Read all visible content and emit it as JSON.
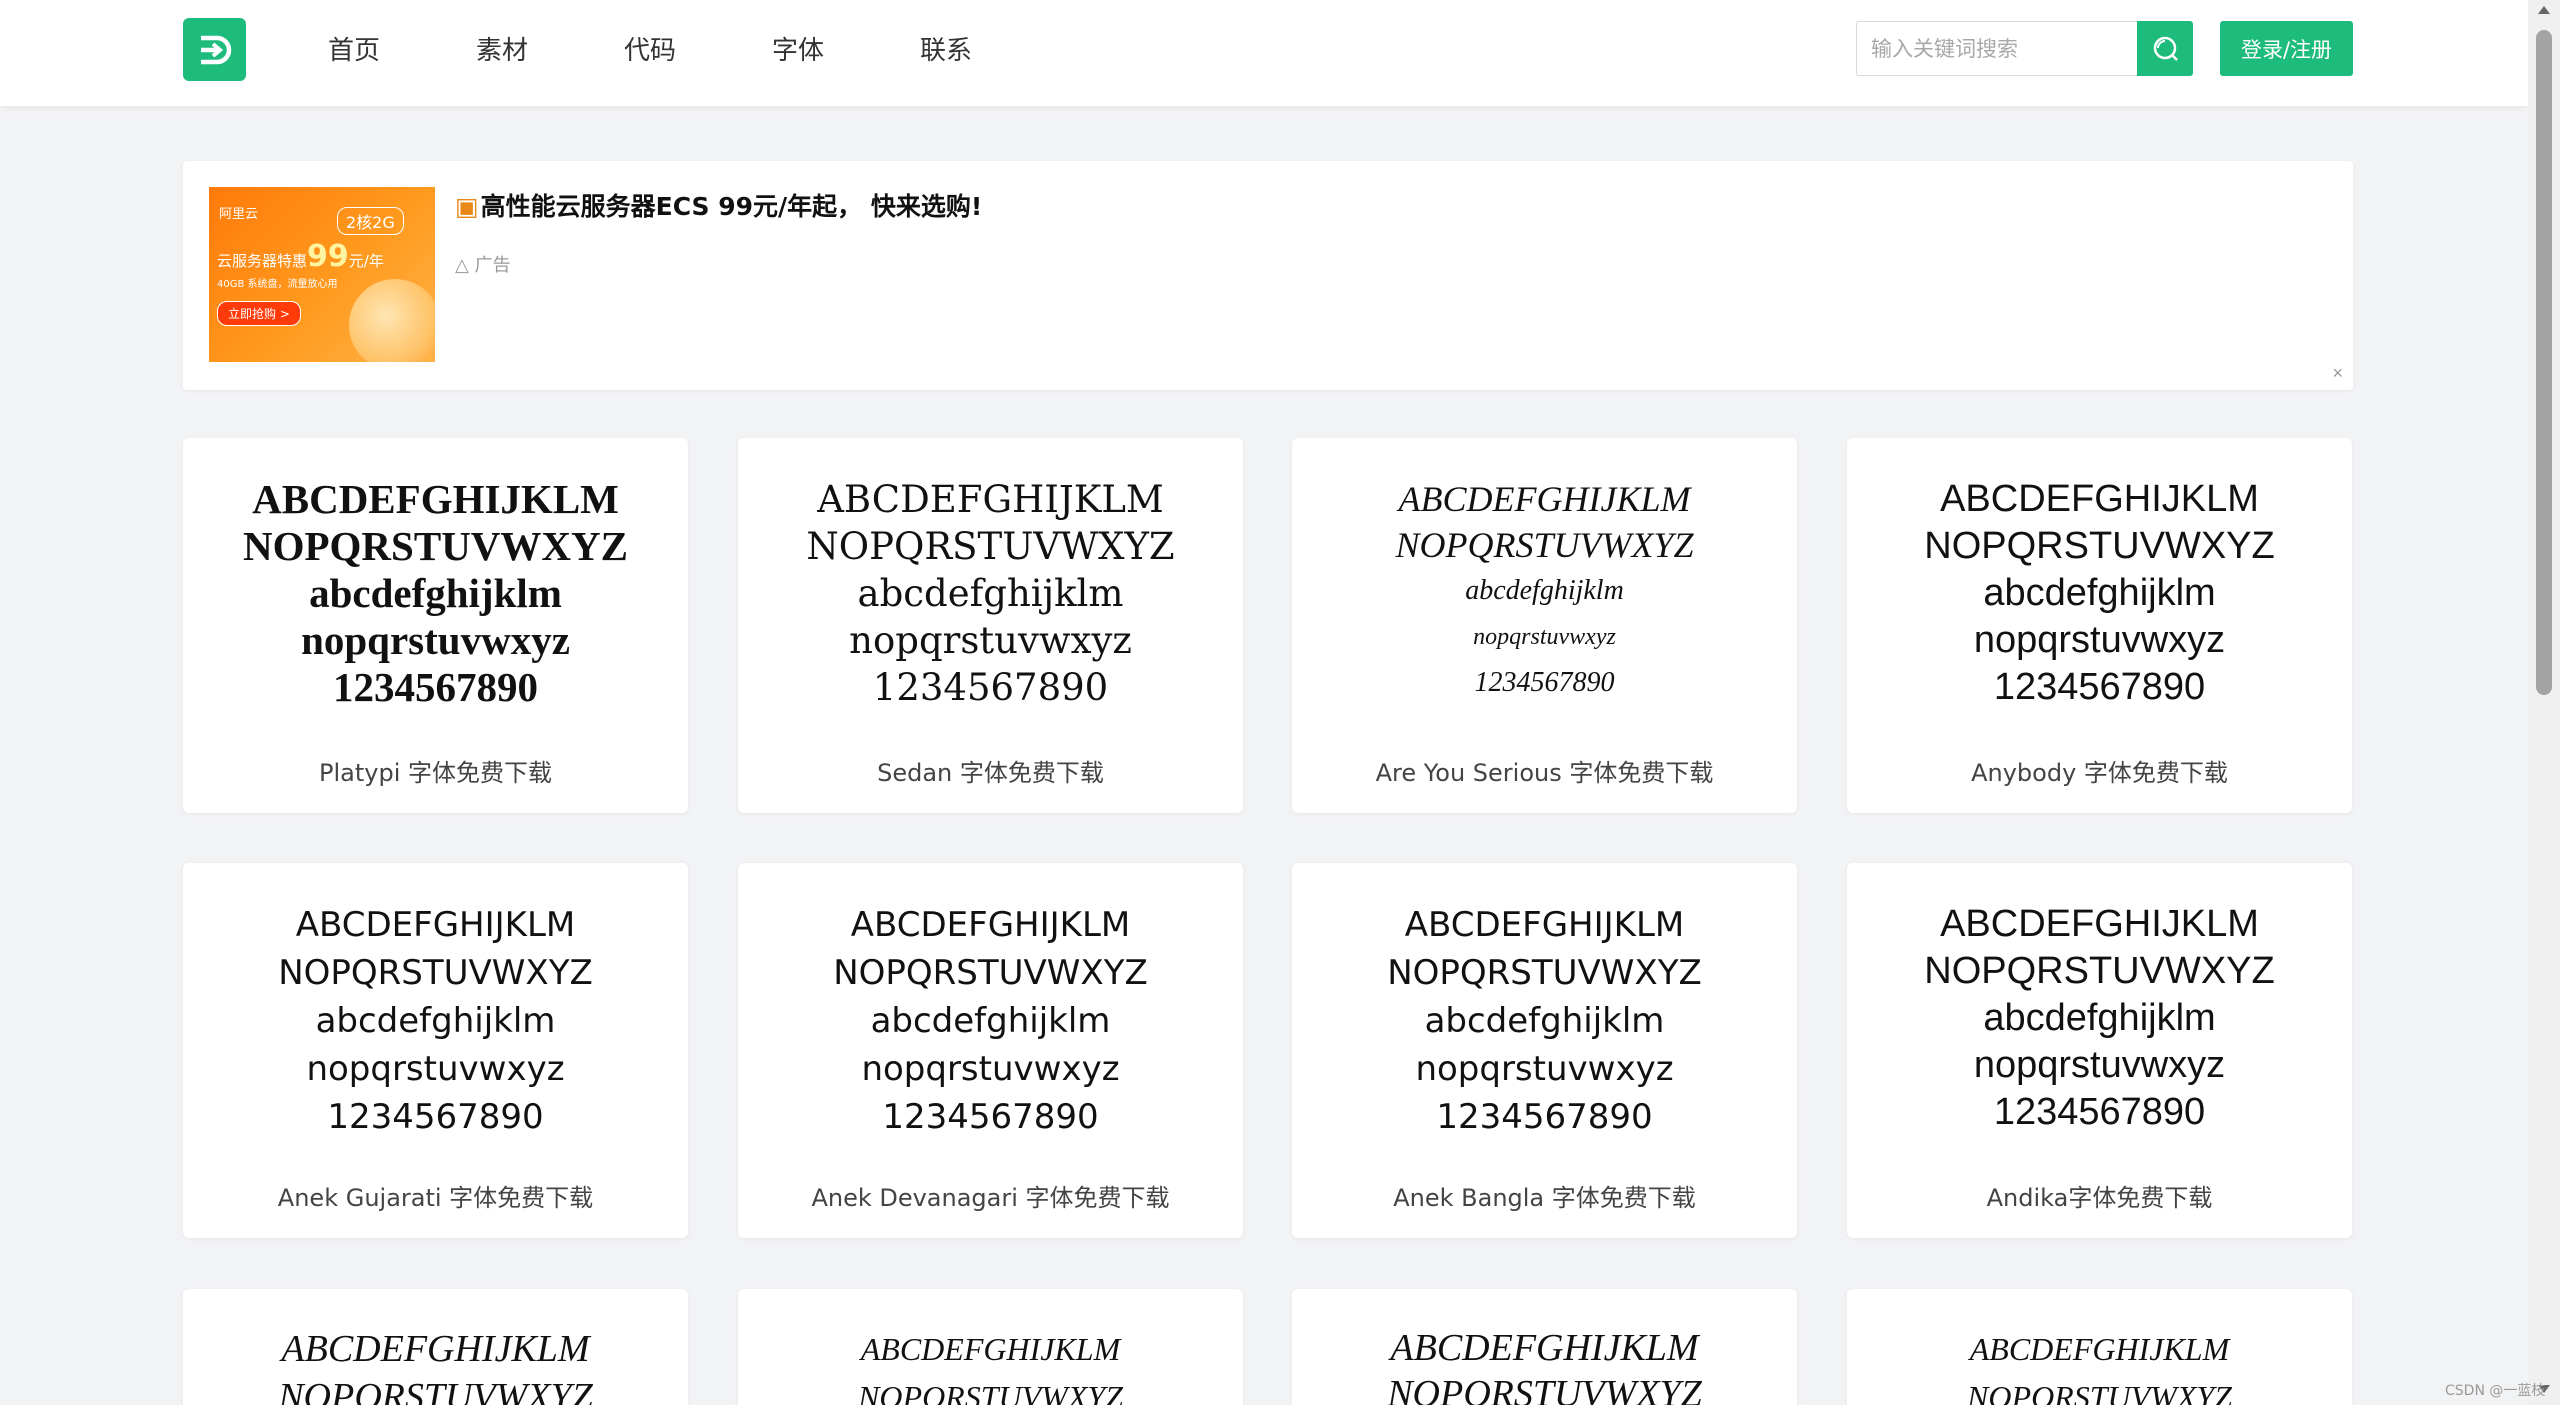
{
  "header": {
    "logo_icon": "d-arrow-logo-icon",
    "brand_color": "#1ebc7c",
    "nav": [
      "首页",
      "素材",
      "代码",
      "字体",
      "联系"
    ],
    "search_placeholder": "输入关键词搜索",
    "search_icon": "search-icon",
    "login_label": "登录/注册"
  },
  "ad": {
    "image": {
      "brand": "阿里云",
      "spec": "2核2G",
      "headline_pre": "云服务器特惠",
      "headline_price": "99",
      "headline_unit": "元/年",
      "sub": "40GB 系统盘，流量放心用",
      "cta": "立即抢购 >"
    },
    "gift_icon": "gift-icon",
    "title": "高性能云服务器ECS 99元/年起， 快来选购!",
    "tag": "广告",
    "close": "×"
  },
  "specimen": {
    "upper1": "ABCDEFGHIJKLM",
    "upper2": "NOPQRSTUVWXYZ",
    "lower1": "abcdefghijklm",
    "lower2": "nopqrstuvwxyz",
    "digits": "1234567890"
  },
  "fonts": [
    {
      "title": "Platypi 字体免费下载"
    },
    {
      "title": "Sedan 字体免费下载"
    },
    {
      "title": "Are You Serious 字体免费下载"
    },
    {
      "title": "Anybody 字体免费下载"
    },
    {
      "title": "Anek Gujarati 字体免费下载"
    },
    {
      "title": "Anek Devanagari 字体免费下载"
    },
    {
      "title": "Anek Bangla 字体免费下载"
    },
    {
      "title": "Andika字体免费下载"
    }
  ],
  "partial_row": {
    "upper1": "ABCDEFGHIJKLM",
    "upper2": "NOPQRSTUVWXYZ"
  },
  "watermark": "CSDN @一蓝枝"
}
